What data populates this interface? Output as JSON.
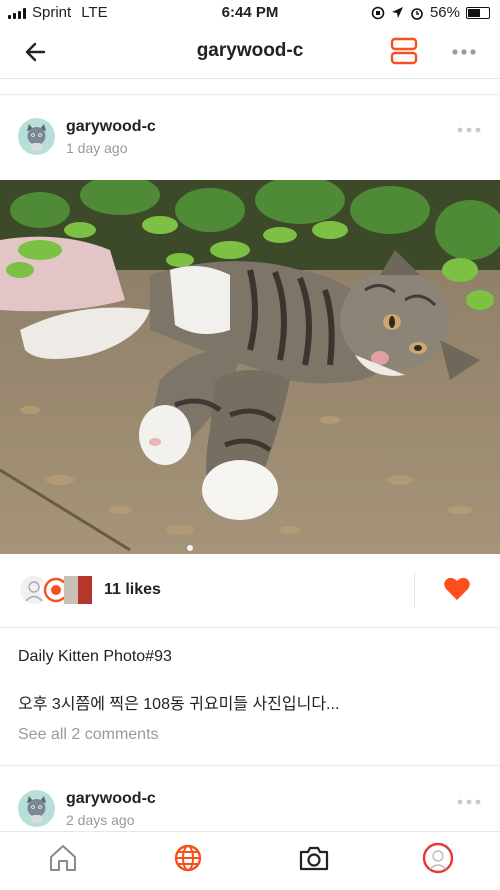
{
  "status_bar": {
    "carrier": "Sprint",
    "network": "LTE",
    "time": "6:44 PM",
    "battery": "56%"
  },
  "navbar": {
    "title": "garywood-c",
    "back_icon": "arrow-left-icon",
    "layout_icon": "layout-rows-icon",
    "more_icon": "more-horizontal-icon"
  },
  "post": {
    "author": "garywood-c",
    "time": "1 day ago",
    "likes": "11 likes",
    "caption_title": "Daily Kitten Photo#93",
    "caption_text": "오후 3시쯤에 찍은 108동 귀요미들 사진입니다...",
    "comments_link": "See all 2 comments"
  },
  "next_post": {
    "author": "garywood-c",
    "time": "2 days ago"
  },
  "tabbar": {
    "items": [
      "home-icon",
      "globe-icon",
      "camera-icon",
      "profile-icon"
    ]
  },
  "colors": {
    "accent": "#F4511E",
    "heart": "#FF4E1A",
    "muted": "#999999",
    "avatar_bg": "#B7DFD7"
  }
}
